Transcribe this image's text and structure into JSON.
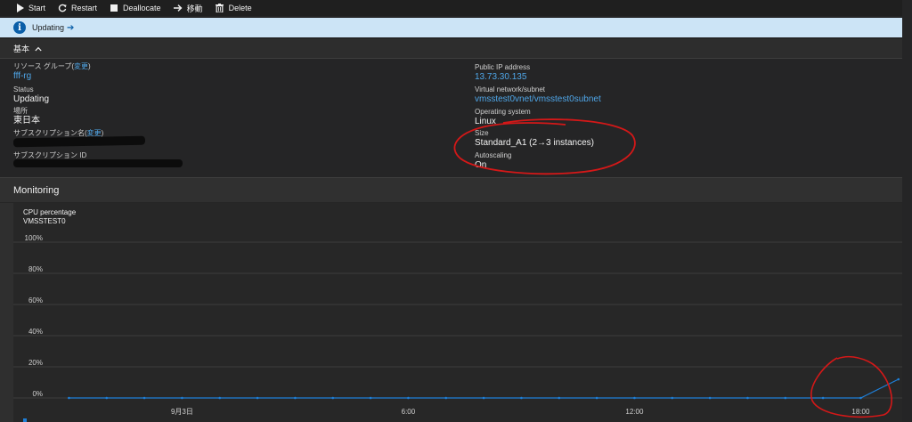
{
  "toolbar": {
    "start": "Start",
    "restart": "Restart",
    "deallocate": "Deallocate",
    "move": "移動",
    "delete": "Delete"
  },
  "notification": {
    "text": "Updating"
  },
  "essentials": {
    "header": "基本",
    "resource_group_label": "リソース グループ",
    "change_link": "変更",
    "resource_group_value": "fff-rg",
    "status_label": "Status",
    "status_value": "Updating",
    "location_label": "場所",
    "location_value": "東日本",
    "subscription_name_label": "サブスクリプション名",
    "subscription_id_label": "サブスクリプション ID",
    "public_ip_label": "Public IP address",
    "public_ip_value": "13.73.30.135",
    "vnet_label": "Virtual network/subnet",
    "vnet_value": "vmsstest0vnet/vmsstest0subnet",
    "os_label": "Operating system",
    "os_value": "Linux",
    "size_label": "Size",
    "size_value": "Standard_A1 (2→3 instances)",
    "autoscaling_label": "Autoscaling",
    "autoscaling_value": "On"
  },
  "monitoring": {
    "header": "Monitoring",
    "chart_title": "CPU percentage",
    "chart_subtitle": "VMSSTEST0"
  },
  "colors": {
    "accent": "#4fa6e8",
    "series": "#1e7fd8",
    "annotation": "#d41818"
  },
  "chart_data": {
    "type": "line",
    "title": "CPU percentage",
    "subtitle": "VMSSTEST0",
    "yticks": [
      "100%",
      "80%",
      "60%",
      "40%",
      "20%",
      "0%"
    ],
    "ylim": [
      0,
      100
    ],
    "xticks": [
      "9月3日",
      "6:00",
      "12:00",
      "18:00"
    ],
    "xtick_hours": [
      0,
      6,
      12,
      18
    ],
    "xlim_hours": [
      -3.6,
      19.1
    ],
    "grid": true,
    "series": [
      {
        "name": "",
        "x_hours": [
          -3,
          -2,
          -1,
          0,
          1,
          2,
          3,
          4,
          5,
          6,
          7,
          8,
          9,
          10,
          11,
          12,
          13,
          14,
          15,
          16,
          17,
          18,
          19
        ],
        "values": [
          0,
          0,
          0,
          0,
          0,
          0,
          0,
          0,
          0,
          0,
          0,
          0,
          0,
          0,
          0,
          0,
          0,
          0,
          0,
          0,
          0,
          0,
          12
        ]
      }
    ]
  }
}
